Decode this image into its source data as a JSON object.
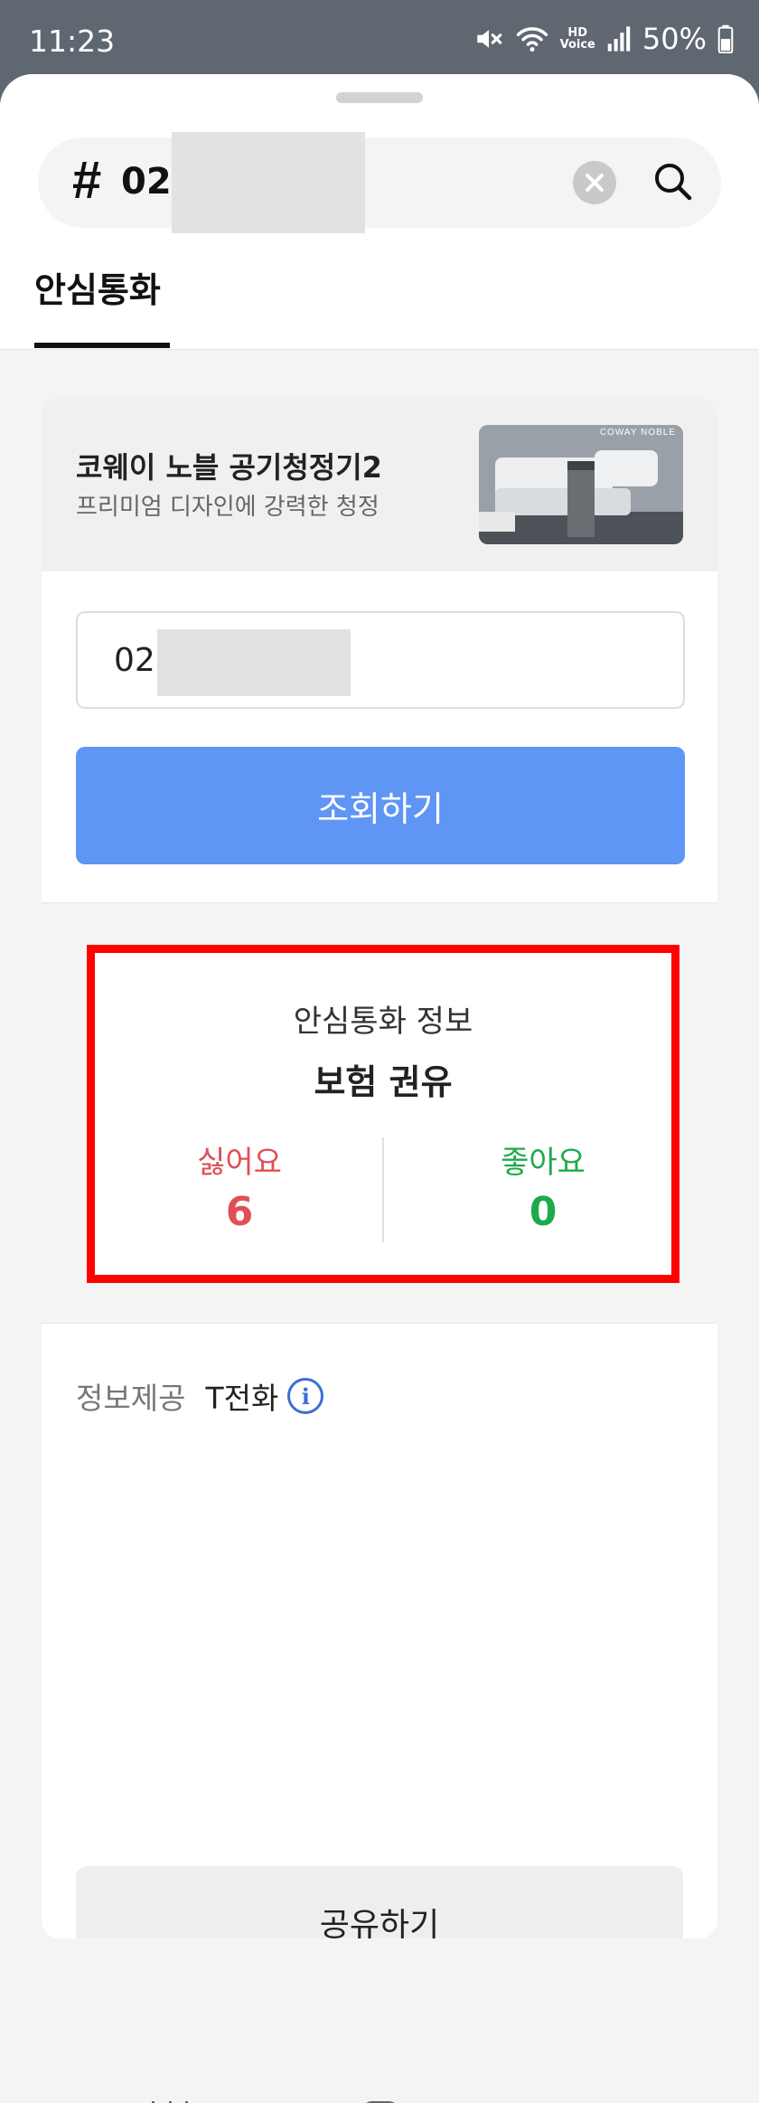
{
  "status_bar": {
    "time": "11:23",
    "battery": "50%",
    "icons": [
      "mute-icon",
      "wifi-icon",
      "hd-voice-icon",
      "signal-icon",
      "battery-icon"
    ]
  },
  "search": {
    "hash": "#",
    "value": "02",
    "icons": [
      "clear-icon",
      "search-icon"
    ]
  },
  "tab": {
    "label": "안심통화"
  },
  "ad": {
    "title": "코웨이 노블 공기청정기2",
    "subtitle": "프리미엄 디자인에 강력한 청정",
    "image_brand": "COWAY NOBLE"
  },
  "number_input": {
    "value": "02"
  },
  "lookup_button": {
    "label": "조회하기"
  },
  "info": {
    "title": "안심통화 정보",
    "category": "보험 권유",
    "dislike_label": "싫어요",
    "dislike_count": "6",
    "like_label": "좋아요",
    "like_count": "0"
  },
  "provider": {
    "label": "정보제공",
    "value": "T전화",
    "icon": "info-icon"
  },
  "share_button": {
    "label": "공유하기"
  },
  "nav_bar": {
    "icons": [
      "recents-icon",
      "home-icon",
      "back-icon"
    ]
  },
  "colors": {
    "primary_button": "#5f95f5",
    "highlight_border": "#ff0000",
    "dislike": "#e04f55",
    "like": "#1eaa4c"
  }
}
